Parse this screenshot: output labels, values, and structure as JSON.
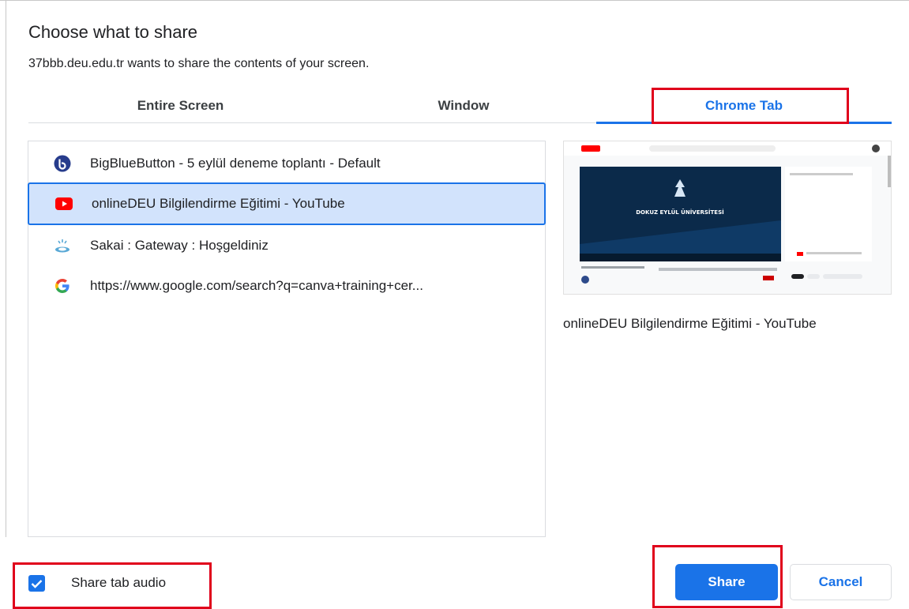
{
  "dialog": {
    "title": "Choose what to share",
    "subtitle": "37bbb.deu.edu.tr wants to share the contents of your screen."
  },
  "tabs": [
    {
      "label": "Entire Screen",
      "selected": false
    },
    {
      "label": "Window",
      "selected": false
    },
    {
      "label": "Chrome Tab",
      "selected": true
    }
  ],
  "list": {
    "items": [
      {
        "label": "BigBlueButton - 5 eylül deneme toplantı - Default",
        "icon": "bigbluebutton-icon",
        "selected": false
      },
      {
        "label": "onlineDEU Bilgilendirme Eğitimi - YouTube",
        "icon": "youtube-icon",
        "selected": true
      },
      {
        "label": "Sakai : Gateway : Hoşgeldiniz",
        "icon": "sakai-icon",
        "selected": false
      },
      {
        "label": "https://www.google.com/search?q=canva+training+cer...",
        "icon": "google-icon",
        "selected": false
      }
    ]
  },
  "preview": {
    "caption": "onlineDEU Bilgilendirme Eğitimi - YouTube",
    "video_text": "DOKUZ EYLÜL ÜNİVERSİTESİ"
  },
  "footer": {
    "share_audio_label": "Share tab audio",
    "share_audio_checked": true,
    "share_label": "Share",
    "cancel_label": "Cancel"
  },
  "colors": {
    "accent": "#1a73e8",
    "selected_row": "#d2e3fc",
    "highlight": "#e0001b"
  }
}
